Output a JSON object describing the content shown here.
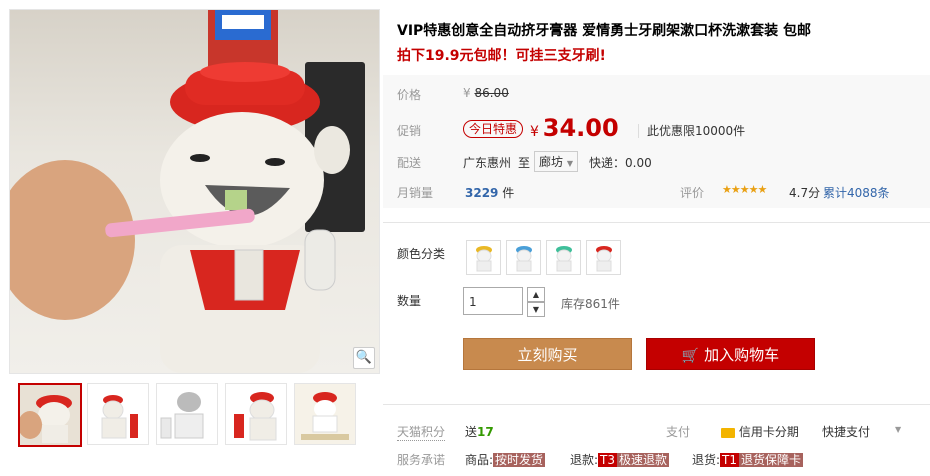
{
  "product": {
    "title": "VIP特惠创意全自动挤牙膏器 爱情勇士牙刷架漱口杯洗漱套装 包邮",
    "subtitle": "拍下19.9元包邮！可挂三支牙刷!"
  },
  "price": {
    "label": "价格",
    "currency": "¥",
    "original": "86.00"
  },
  "promo": {
    "label": "促销",
    "tag": "今日特惠",
    "currency": "¥",
    "price": "34.00",
    "limit": "此优惠限10000件"
  },
  "shipping": {
    "label": "配送",
    "from": "广东惠州",
    "to_word": "至",
    "to_city": "廊坊",
    "express": "快递：0.00"
  },
  "sales": {
    "label": "月销量",
    "count": "3229",
    "unit": "件",
    "rating_label": "评价",
    "score": "4.7分",
    "review_count": "累计4088条"
  },
  "color": {
    "label": "颜色分类",
    "options": [
      "yellow",
      "blue",
      "green",
      "red"
    ]
  },
  "quantity": {
    "label": "数量",
    "value": "1",
    "stock": "库存861件"
  },
  "actions": {
    "buy": "立刻购买",
    "cart": "加入购物车"
  },
  "points": {
    "label": "天猫积分",
    "prefix": "送",
    "value": "17"
  },
  "payment": {
    "label": "支付",
    "credit": "信用卡分期",
    "quick": "快捷支付"
  },
  "service": {
    "label": "服务承诺",
    "goods_label": "商品:",
    "goods_tag": "按时发货",
    "refund_label": "退款:",
    "refund_t": "T3",
    "refund_tag": "极速退款",
    "return_label": "退货:",
    "return_t": "T1",
    "return_tag": "退货保障卡"
  },
  "colors": {
    "accent": "#c40000",
    "buy_button": "#c88a4e",
    "label_gray": "#999999"
  }
}
